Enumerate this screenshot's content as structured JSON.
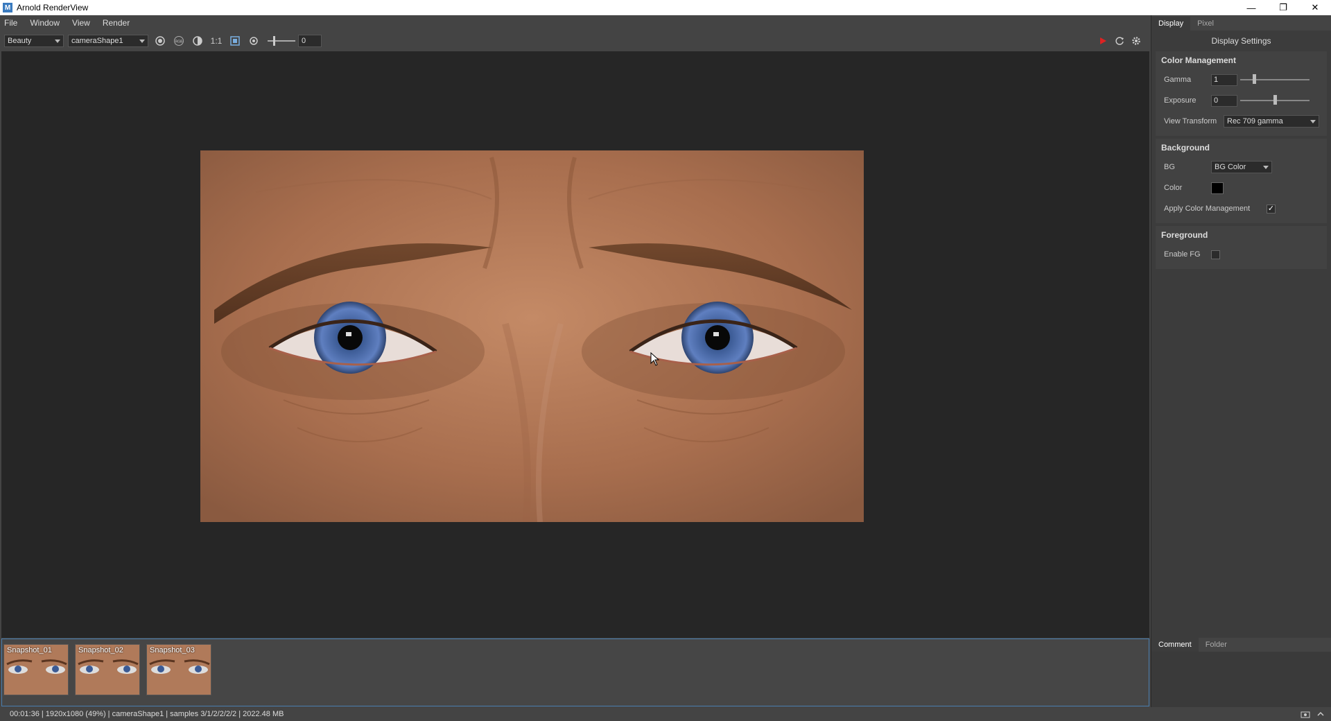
{
  "window": {
    "title": "Arnold RenderView",
    "app_icon": "M"
  },
  "menu": [
    "File",
    "Window",
    "View",
    "Render"
  ],
  "toolbar": {
    "aov": "Beauty",
    "camera": "cameraShape1",
    "ratio_label": "1:1",
    "exposure_value": "0"
  },
  "render": {
    "description_colors": {
      "skin": "#b57a58",
      "iris": "#4a66a8"
    }
  },
  "snapshots": [
    "Snapshot_01",
    "Snapshot_02",
    "Snapshot_03"
  ],
  "status": "00:01:36 | 1920x1080 (49%) | cameraShape1 | samples 3/1/2/2/2/2 | 2022.48 MB",
  "panel": {
    "tabs": [
      "Display",
      "Pixel"
    ],
    "title": "Display Settings",
    "color_management": {
      "header": "Color Management",
      "gamma_label": "Gamma",
      "gamma_value": "1",
      "gamma_slider": 0.2,
      "exposure_label": "Exposure",
      "exposure_value": "0",
      "exposure_slider": 0.5,
      "view_transform_label": "View Transform",
      "view_transform_value": "Rec 709 gamma"
    },
    "background": {
      "header": "Background",
      "bg_label": "BG",
      "bg_value": "BG Color",
      "color_label": "Color",
      "color_value": "#000000",
      "apply_cm_label": "Apply Color Management",
      "apply_cm_checked": true
    },
    "foreground": {
      "header": "Foreground",
      "enable_fg_label": "Enable FG",
      "enable_fg_checked": false
    },
    "bottom_tabs": [
      "Comment",
      "Folder"
    ]
  }
}
